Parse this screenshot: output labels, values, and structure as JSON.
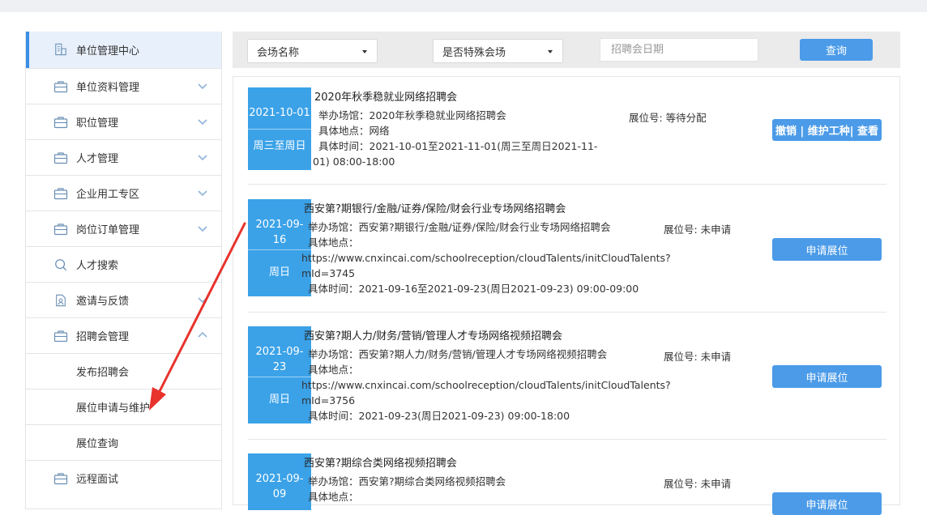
{
  "sidebar": {
    "items": [
      {
        "label": "单位管理中心",
        "icon": "building-icon",
        "expand": ""
      },
      {
        "label": "单位资料管理",
        "icon": "briefcase-icon",
        "expand": "chevron-down"
      },
      {
        "label": "职位管理",
        "icon": "briefcase-icon",
        "expand": "chevron-down"
      },
      {
        "label": "人才管理",
        "icon": "briefcase-icon",
        "expand": "chevron-down"
      },
      {
        "label": "企业用工专区",
        "icon": "briefcase-icon",
        "expand": "chevron-down"
      },
      {
        "label": "岗位订单管理",
        "icon": "briefcase-icon",
        "expand": "chevron-down"
      },
      {
        "label": "人才搜索",
        "icon": "search-icon",
        "expand": ""
      },
      {
        "label": "邀请与反馈",
        "icon": "invite-document-icon",
        "expand": "chevron-down"
      },
      {
        "label": "招聘会管理",
        "icon": "briefcase-icon",
        "expand": "chevron-up"
      },
      {
        "label": "发布招聘会",
        "icon": "",
        "expand": ""
      },
      {
        "label": "展位申请与维护",
        "icon": "",
        "expand": ""
      },
      {
        "label": "展位查询",
        "icon": "",
        "expand": ""
      },
      {
        "label": "远程面试",
        "icon": "briefcase-icon",
        "expand": ""
      }
    ]
  },
  "filters": {
    "venue_name": "会场名称",
    "special_venue": "是否特殊会场",
    "date_placeholder": "招聘会日期",
    "query_label": "查询"
  },
  "cards": [
    {
      "date": "2021-10-01",
      "weekday": "周三至周日",
      "title": "2020年秋季稳就业网络招聘会",
      "venue": "举办场馆：2020年秋季稳就业网络招聘会",
      "booth": "展位号: 等待分配",
      "location_label": "具体地点：网络",
      "location_url": "",
      "time_line1": "具体时间：2021-10-01至2021-11-01(周三至周日2021-11-",
      "time_line2": "01)  08:00-18:00",
      "action": "撤销 | 维护工种| 查看"
    },
    {
      "date": "2021-09-16",
      "weekday": "周日",
      "title": "西安第?期银行/金融/证券/保险/财会行业专场网络招聘会",
      "venue": "举办场馆：西安第?期银行/金融/证券/保险/财会行业专场网络招聘会",
      "booth": "展位号: 未申请",
      "location_label": "具体地点：",
      "location_url": "https://www.cnxincai.com/schoolreception/cloudTalents/initCloudTalents?",
      "location_url2": "mId=3745",
      "time_line1": "具体时间：2021-09-16至2021-09-23(周日2021-09-23)  09:00-09:00",
      "action": "申请展位"
    },
    {
      "date": "2021-09-23",
      "weekday": "周日",
      "title": "西安第?期人力/财务/营销/管理人才专场网络视频招聘会",
      "venue": "举办场馆：西安第?期人力/财务/营销/管理人才专场网络视频招聘会",
      "booth": "展位号: 未申请",
      "location_label": "具体地点：",
      "location_url": "https://www.cnxincai.com/schoolreception/cloudTalents/initCloudTalents?",
      "location_url2": "mId=3756",
      "time_line1": "具体时间：2021-09-23(周日2021-09-23)  09:00-18:00",
      "action": "申请展位"
    },
    {
      "date": "2021-09-09",
      "weekday": "",
      "title": "西安第?期综合类网络视频招聘会",
      "venue": "举办场馆：西安第?期综合类网络视频招聘会",
      "booth": "展位号: 未申请",
      "location_label": "具体地点：",
      "action": "申请展位"
    }
  ],
  "colors": {
    "accent": "#4b9be8",
    "date_box": "#3ba2e8",
    "active_bg": "#e7f0fb",
    "annotation_arrow": "#e8322c"
  }
}
